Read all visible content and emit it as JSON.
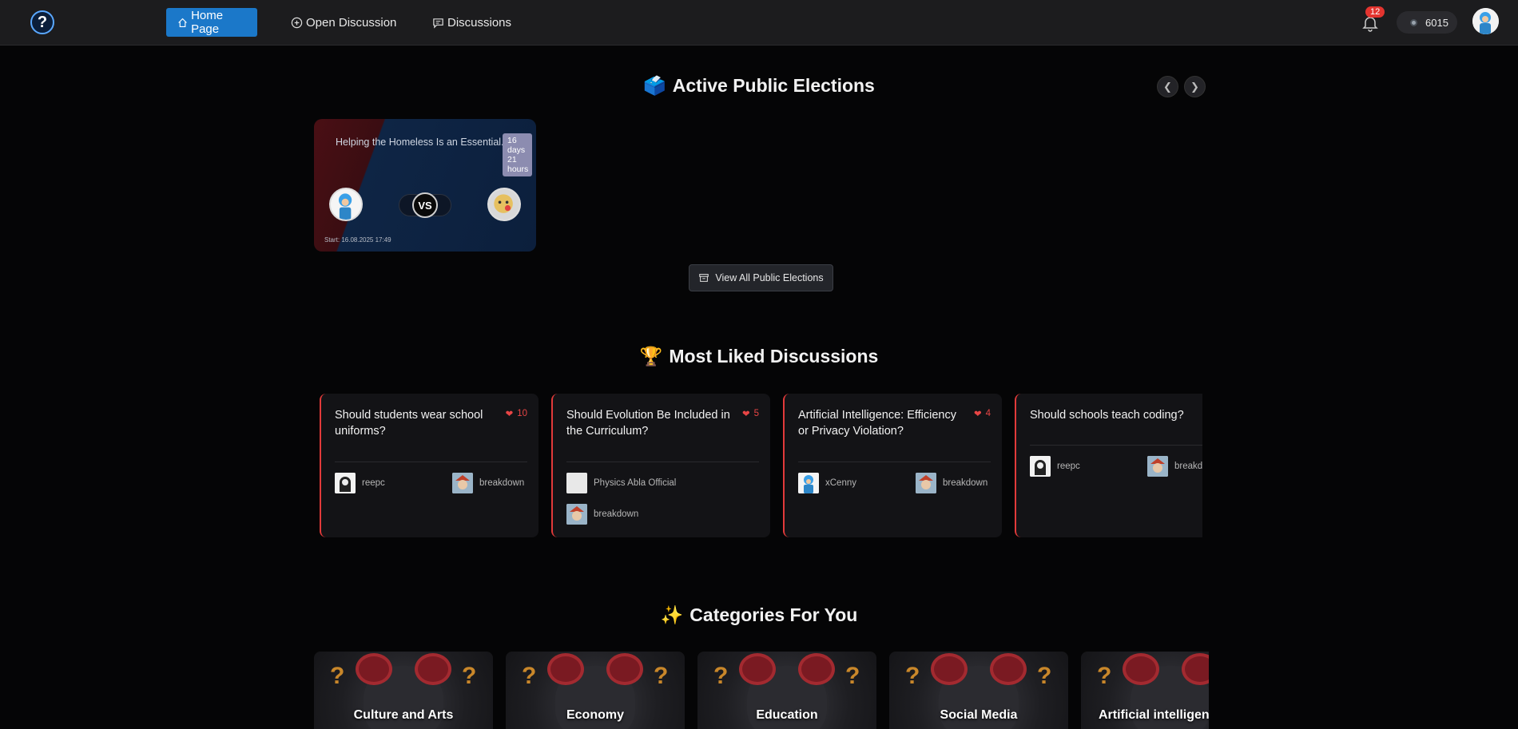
{
  "nav": {
    "home_label": "Home Page",
    "open_discussion_label": "Open Discussion",
    "discussions_label": "Discussions",
    "notification_count": "12",
    "coins": "6015"
  },
  "elections": {
    "title": "Active Public Elections",
    "title_emoji": "🗳️",
    "card": {
      "title": "Helping the Homeless Is an Essential...",
      "time_days": "16",
      "time_days_label": "days",
      "time_hours": "21",
      "time_hours_label": "hours",
      "vs": "VS",
      "start": "Start: 16.08.2025 17:49"
    },
    "view_all_label": "View All Public Elections"
  },
  "liked": {
    "title": "Most Liked Discussions",
    "title_emoji": "🏆",
    "cards": [
      {
        "title": "Should students wear school uniforms?",
        "likes": "10",
        "users": [
          "reepc",
          "breakdown"
        ]
      },
      {
        "title": "Should Evolution Be Included in the Curriculum?",
        "likes": "5",
        "users": [
          "Physics Abla Official",
          "breakdown"
        ]
      },
      {
        "title": "Artificial Intelligence: Efficiency or Privacy Violation?",
        "likes": "4",
        "users": [
          "xCenny",
          "breakdown"
        ]
      },
      {
        "title": "Should schools teach coding?",
        "likes": "",
        "users": [
          "reepc",
          "breakdown"
        ]
      }
    ]
  },
  "categories": {
    "title": "Categories For You",
    "title_emoji": "✨",
    "items": [
      "Culture and Arts",
      "Economy",
      "Education",
      "Social Media",
      "Artificial intelligence"
    ]
  },
  "colors": {
    "accent": "#1b78c9",
    "like": "#e84545",
    "card_border": "#e23a3a"
  }
}
